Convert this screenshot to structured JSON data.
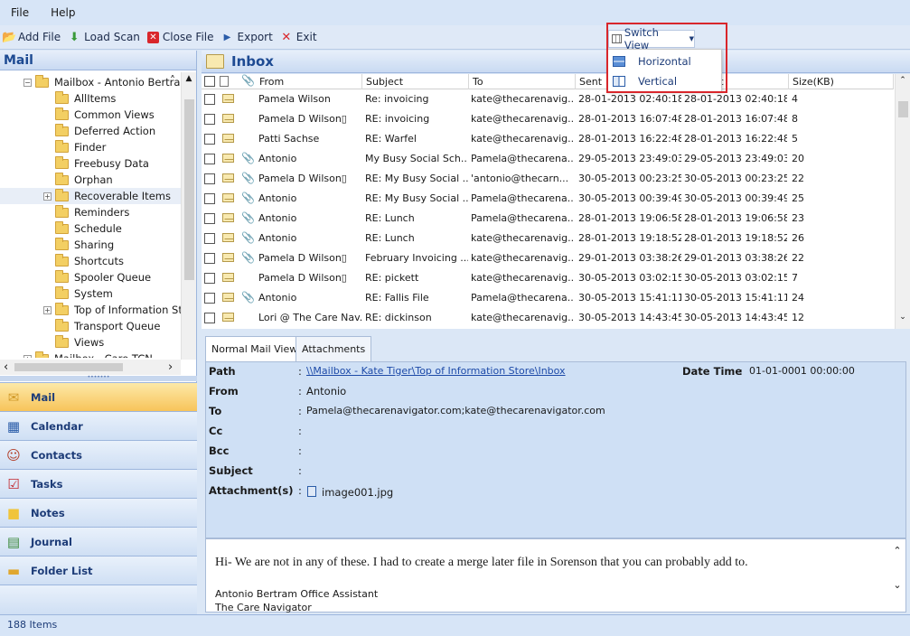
{
  "menu": {
    "file": "File",
    "help": "Help"
  },
  "toolbar": {
    "add_file": "Add File",
    "load_scan": "Load Scan",
    "close_file": "Close File",
    "export": "Export",
    "exit": "Exit",
    "switch_view": "Switch View"
  },
  "switch_view_menu": {
    "horizontal": "Horizontal",
    "vertical": "Vertical"
  },
  "sidebar": {
    "title": "Mail",
    "tree": [
      {
        "label": "Mailbox - Antonio Bertran",
        "level": 0,
        "expander": "−"
      },
      {
        "label": "AllItems",
        "level": 1
      },
      {
        "label": "Common Views",
        "level": 1
      },
      {
        "label": "Deferred Action",
        "level": 1
      },
      {
        "label": "Finder",
        "level": 1
      },
      {
        "label": "Freebusy Data",
        "level": 1
      },
      {
        "label": "Orphan",
        "level": 1
      },
      {
        "label": "Recoverable Items",
        "level": 1,
        "expander": "+"
      },
      {
        "label": "Reminders",
        "level": 1
      },
      {
        "label": "Schedule",
        "level": 1
      },
      {
        "label": "Sharing",
        "level": 1
      },
      {
        "label": "Shortcuts",
        "level": 1
      },
      {
        "label": "Spooler Queue",
        "level": 1
      },
      {
        "label": "System",
        "level": 1
      },
      {
        "label": "Top of Information Stc",
        "level": 1,
        "expander": "+"
      },
      {
        "label": "Transport Queue",
        "level": 1
      },
      {
        "label": "Views",
        "level": 1
      },
      {
        "label": "Mailbox - Care TCN",
        "level": 0,
        "expander": "+"
      }
    ],
    "nav": [
      {
        "label": "Mail",
        "icon": "mail-icon"
      },
      {
        "label": "Calendar",
        "icon": "calendar-icon"
      },
      {
        "label": "Contacts",
        "icon": "contacts-icon"
      },
      {
        "label": "Tasks",
        "icon": "tasks-icon"
      },
      {
        "label": "Notes",
        "icon": "notes-icon"
      },
      {
        "label": "Journal",
        "icon": "journal-icon"
      },
      {
        "label": "Folder List",
        "icon": "folder-list-icon"
      }
    ]
  },
  "inbox": {
    "title": "Inbox",
    "columns": {
      "from": "From",
      "subject": "Subject",
      "to": "To",
      "sent": "Sent",
      "received": "c",
      "size": "Size(KB)"
    },
    "rows": [
      {
        "from": "Pamela Wilson",
        "subject": "Re: invoicing",
        "to": "kate@thecarenavig...",
        "sent": "28-01-2013 02:40:18",
        "received": "28-01-2013 02:40:18",
        "size": "4",
        "attach": false
      },
      {
        "from": "Pamela D Wilson▯",
        "subject": "RE: invoicing",
        "to": "kate@thecarenavig...",
        "sent": "28-01-2013 16:07:48",
        "received": "28-01-2013 16:07:48",
        "size": "8",
        "attach": false
      },
      {
        "from": "Patti Sachse",
        "subject": "RE: Warfel",
        "to": "kate@thecarenavig...",
        "sent": "28-01-2013 16:22:48",
        "received": "28-01-2013 16:22:48",
        "size": "5",
        "attach": false
      },
      {
        "from": "Antonio",
        "subject": "My Busy Social Sch...",
        "to": "Pamela@thecarena...",
        "sent": "29-05-2013 23:49:03",
        "received": "29-05-2013 23:49:03",
        "size": "20",
        "attach": true
      },
      {
        "from": "Pamela D Wilson▯",
        "subject": "RE: My Busy Social ...",
        "to": "'antonio@thecarn...",
        "sent": "30-05-2013 00:23:25",
        "received": "30-05-2013 00:23:25",
        "size": "22",
        "attach": true
      },
      {
        "from": "Antonio",
        "subject": "RE: My Busy Social ...",
        "to": "Pamela@thecarena...",
        "sent": "30-05-2013 00:39:49",
        "received": "30-05-2013 00:39:49",
        "size": "25",
        "attach": true
      },
      {
        "from": "Antonio",
        "subject": "RE: Lunch",
        "to": "Pamela@thecarena...",
        "sent": "28-01-2013 19:06:58",
        "received": "28-01-2013 19:06:58",
        "size": "23",
        "attach": true
      },
      {
        "from": "Antonio",
        "subject": "RE: Lunch",
        "to": "kate@thecarenavig...",
        "sent": "28-01-2013 19:18:52",
        "received": "28-01-2013 19:18:52",
        "size": "26",
        "attach": true
      },
      {
        "from": "Pamela D Wilson▯",
        "subject": "February Invoicing ...",
        "to": "kate@thecarenavig...",
        "sent": "29-01-2013 03:38:26",
        "received": "29-01-2013 03:38:26",
        "size": "22",
        "attach": true
      },
      {
        "from": "Pamela D Wilson▯",
        "subject": "RE: pickett",
        "to": "kate@thecarenavig...",
        "sent": "30-05-2013 03:02:15",
        "received": "30-05-2013 03:02:15",
        "size": "7",
        "attach": false
      },
      {
        "from": "Antonio",
        "subject": "RE: Fallis File",
        "to": "Pamela@thecarena...",
        "sent": "30-05-2013 15:41:11",
        "received": "30-05-2013 15:41:11",
        "size": "24",
        "attach": true
      },
      {
        "from": "Lori @ The Care Nav...",
        "subject": "RE: dickinson",
        "to": "kate@thecarenavig...",
        "sent": "30-05-2013 14:43:45",
        "received": "30-05-2013 14:43:45",
        "size": "12",
        "attach": false
      }
    ]
  },
  "preview": {
    "tabs": {
      "normal": "Normal Mail View",
      "attachments": "Attachments"
    },
    "labels": {
      "path": "Path",
      "from": "From",
      "to": "To",
      "cc": "Cc",
      "bcc": "Bcc",
      "subject": "Subject",
      "attachments": "Attachment(s)",
      "datetime": "Date Time"
    },
    "colon": ":",
    "path": "\\\\Mailbox - Kate Tiger\\Top of Information Store\\Inbox",
    "datetime": "01-01-0001 00:00:00",
    "from": "Antonio",
    "to": "Pamela@thecarenavigator.com;kate@thecarenavigator.com",
    "attachment": "image001.jpg",
    "body_line1": "Hi- We are not in any of these. I had to create a merge later file in Sorenson that you can probably add to.",
    "body_line2": "Antonio Bertram Office Assistant",
    "body_line3": "The Care Navigator"
  },
  "status": {
    "items": "188 Items"
  }
}
